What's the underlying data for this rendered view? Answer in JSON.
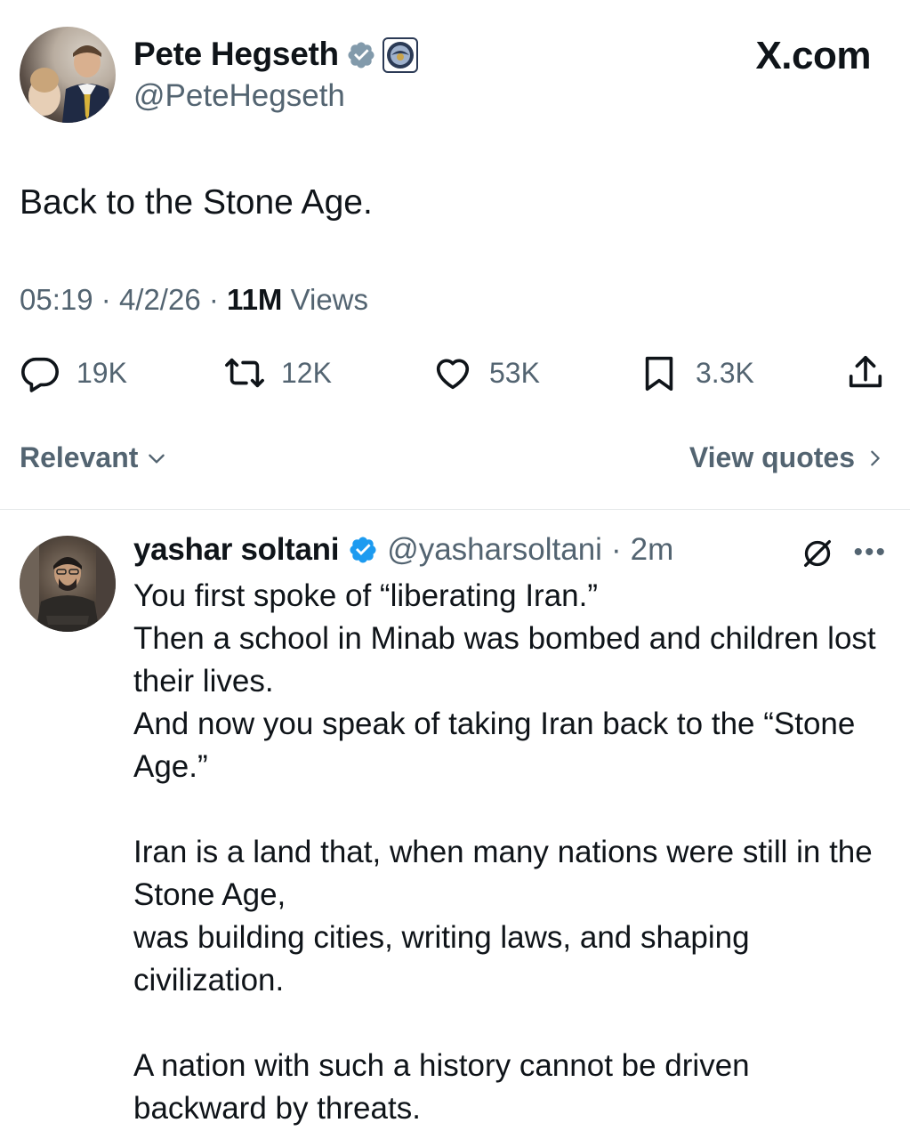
{
  "main_tweet": {
    "author_name": "Pete Hegseth",
    "author_handle": "@PeteHegseth",
    "text": "Back to the Stone Age.",
    "time": "05:19",
    "date": "4/2/26",
    "views_count": "11M",
    "views_label": "Views",
    "actions": {
      "replies": "19K",
      "reposts": "12K",
      "likes": "53K",
      "bookmarks": "3.3K"
    }
  },
  "watermark": "X.com",
  "sort": {
    "label": "Relevant"
  },
  "view_quotes": {
    "label": "View quotes"
  },
  "reply": {
    "author_name": "yashar soltani",
    "author_handle": "@yasharsoltani",
    "age": "2m",
    "lines": [
      "You first spoke of “liberating Iran.”",
      "Then a school in Minab was bombed and children lost their lives.",
      "And now you speak of taking Iran back to the “Stone Age.”",
      "Iran is a land that, when many nations were still in the Stone Age,",
      "was building cities, writing laws, and shaping civilization.",
      "A nation with such a history cannot be driven backward by threats."
    ]
  },
  "colors": {
    "verified_blue": "#1d9bf0",
    "secondary_text": "#536471",
    "primary_text": "#0f1419"
  },
  "icons": [
    "verified-badge-icon",
    "affiliate-seal-icon",
    "reply-icon",
    "repost-icon",
    "like-icon",
    "bookmark-icon",
    "share-icon",
    "chevron-down-icon",
    "chevron-right-icon",
    "grok-icon",
    "more-icon"
  ]
}
